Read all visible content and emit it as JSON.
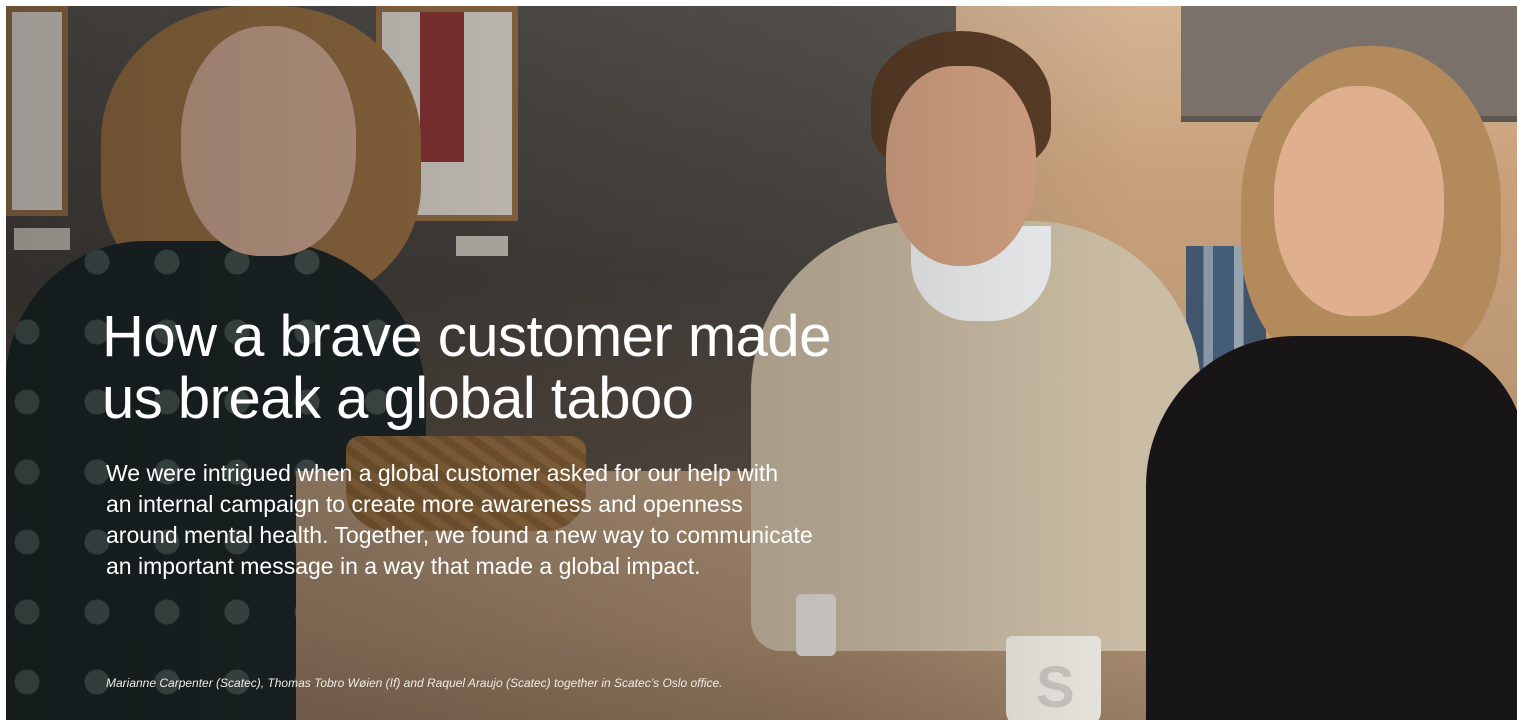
{
  "hero": {
    "title_line1": "How a brave customer made",
    "title_line2": "us break a global taboo",
    "lead_line1": "We were intrigued when a global customer asked for our help with",
    "lead_line2": "an internal campaign to create more awareness and openness",
    "lead_line3": "around mental health. Together, we found a new way to communicate",
    "lead_line4": "an important message in a way that made a global impact.",
    "caption": "Marianne Carpenter (Scatec), Thomas Tobro Wøien (If) and Raquel Araujo (Scatec) together in Scatec’s Oslo office."
  }
}
